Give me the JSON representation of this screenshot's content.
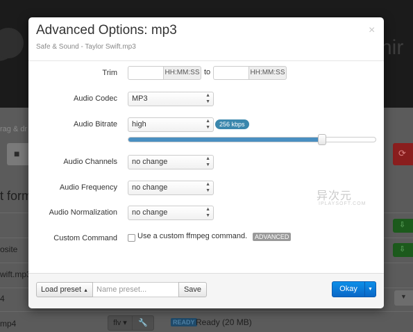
{
  "background": {
    "brand_partial": "hir",
    "hint_text": "rag & dr",
    "heading": "t form",
    "rows": [
      {
        "text": "osite"
      },
      {
        "text": "wift.mp3"
      },
      {
        "text": "4"
      },
      {
        "text": "mp4"
      }
    ],
    "format_select": "flv",
    "ready_badge": "READY",
    "ready_text": "Ready (20 MB)"
  },
  "modal": {
    "title": "Advanced Options: mp3",
    "subtitle": "Safe & Sound - Taylor Swift.mp3",
    "close": "×"
  },
  "trim": {
    "label": "Trim",
    "start_value": "",
    "start_addon": "HH:MM:SS",
    "to_text": "to",
    "end_value": "",
    "end_addon": "HH:MM:SS"
  },
  "audio_codec": {
    "label": "Audio Codec",
    "value": "MP3"
  },
  "audio_bitrate": {
    "label": "Audio Bitrate",
    "value": "high",
    "badge": "256 kbps",
    "slider_fraction": 0.78
  },
  "audio_channels": {
    "label": "Audio Channels",
    "value": "no change"
  },
  "audio_frequency": {
    "label": "Audio Frequency",
    "value": "no change"
  },
  "audio_normalization": {
    "label": "Audio Normalization",
    "value": "no change"
  },
  "custom_command": {
    "label": "Custom Command",
    "checkbox_text": "Use a custom ffmpeg command.",
    "badge": "ADVANCED",
    "checked": false
  },
  "watermark": {
    "cn": "异次元",
    "en": "IPLAYSOFT.COM"
  },
  "footer": {
    "load_preset": "Load preset",
    "preset_placeholder": "Name preset...",
    "save": "Save",
    "ok": "Okay"
  },
  "colors": {
    "accent": "#0a6fd6",
    "slider": "#4a8fc1",
    "badge_blue": "#3a87ad"
  }
}
